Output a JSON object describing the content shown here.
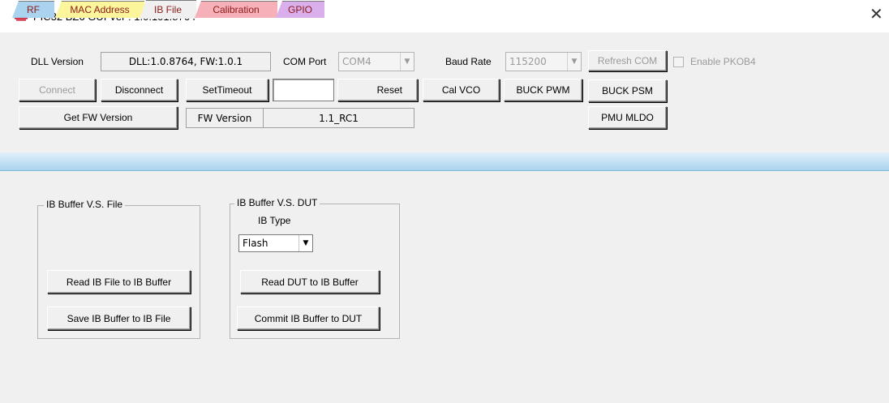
{
  "window": {
    "title": "PIC32 BZ6 GUI Ver : 1.0.101.8764",
    "close_glyph": "✕"
  },
  "header": {
    "dll_label": "DLL Version",
    "dll_value": "DLL:1.0.8764, FW:1.0.1",
    "com_port_label": "COM Port",
    "com_port_value": "COM4",
    "baud_rate_label": "Baud Rate",
    "baud_rate_value": "115200",
    "refresh_com": "Refresh COM",
    "enable_pkob4": "Enable PKOB4",
    "connect": "Connect",
    "disconnect": "Disconnect",
    "set_timeout": "SetTimeout",
    "timeout_value": "",
    "reset": "Reset",
    "cal_vco": "Cal VCO",
    "buck_pwm": "BUCK PWM",
    "buck_psm": "BUCK PSM",
    "get_fw_version": "Get FW Version",
    "fw_version_label": "FW Version",
    "fw_version_value": "1.1_RC1",
    "pmu_mldo": "PMU MLDO"
  },
  "tabs": [
    {
      "label": "RF",
      "color": "#a9d3ee"
    },
    {
      "label": "MAC Address",
      "color": "#fbf59b"
    },
    {
      "label": "IB File",
      "color": "#f0f0f0",
      "active": true
    },
    {
      "label": "Calibration",
      "color": "#f6b0b8"
    },
    {
      "label": "GPIO",
      "color": "#d9b0ec"
    }
  ],
  "ib_file": {
    "group_file_title": "IB Buffer V.S. File",
    "read_ib_file": "Read IB File to IB Buffer",
    "save_ib_buffer": "Save IB Buffer to IB File",
    "group_dut_title": "IB Buffer V.S. DUT",
    "ib_type_label": "IB Type",
    "ib_type_value": "Flash",
    "read_dut": "Read DUT to IB Buffer",
    "commit_ib_buffer": "Commit IB Buffer to DUT"
  }
}
